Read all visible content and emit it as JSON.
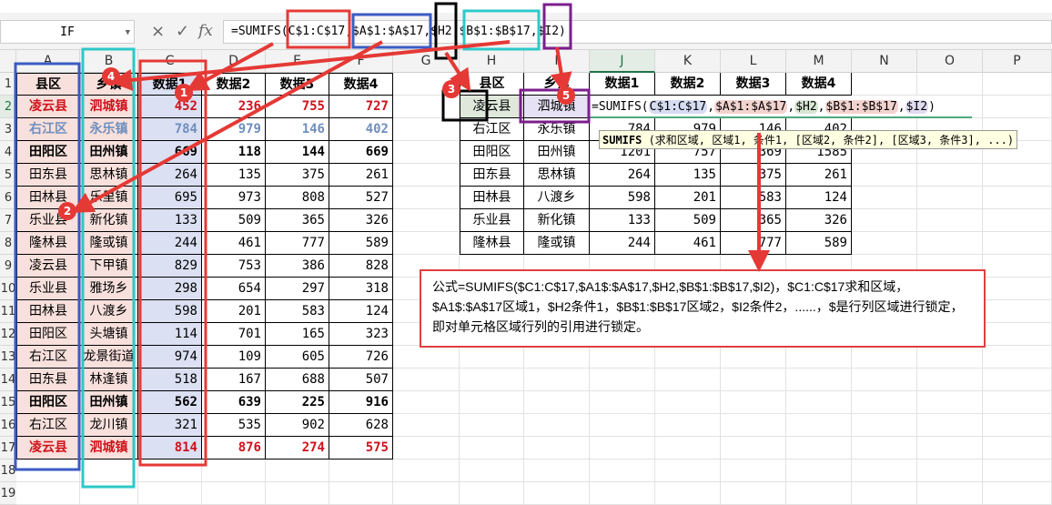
{
  "name_box": "IF",
  "formula_bar": {
    "cancel_icon": "×",
    "confirm_icon": "✓",
    "fx_label": "fx",
    "formula": "=SUMIFS(C$1:C$17,$A$1:$A$17,$H2,$B$1:$B$17,$I2)"
  },
  "columns": [
    "A",
    "B",
    "C",
    "D",
    "E",
    "F",
    "G",
    "H",
    "I",
    "J",
    "K",
    "L",
    "M",
    "N",
    "O",
    "P"
  ],
  "rows": [
    "1",
    "2",
    "3",
    "4",
    "5",
    "6",
    "7",
    "8",
    "9",
    "10",
    "11",
    "12",
    "13",
    "14",
    "15",
    "16",
    "17",
    "18",
    "19"
  ],
  "left_table": {
    "headers": [
      "县区",
      "乡镇",
      "数据1",
      "数据2",
      "数据3",
      "数据4"
    ],
    "rows": [
      [
        "凌云县",
        "泗城镇",
        "452",
        "236",
        "755",
        "727"
      ],
      [
        "右江区",
        "永乐镇",
        "784",
        "979",
        "146",
        "402"
      ],
      [
        "田阳区",
        "田州镇",
        "669",
        "118",
        "144",
        "669"
      ],
      [
        "田东县",
        "思林镇",
        "264",
        "135",
        "375",
        "261"
      ],
      [
        "田林县",
        "乐里镇",
        "695",
        "973",
        "808",
        "527"
      ],
      [
        "乐业县",
        "新化镇",
        "133",
        "509",
        "365",
        "326"
      ],
      [
        "隆林县",
        "隆或镇",
        "244",
        "461",
        "777",
        "589"
      ],
      [
        "凌云县",
        "下甲镇",
        "829",
        "753",
        "386",
        "828"
      ],
      [
        "乐业县",
        "雅场乡",
        "298",
        "654",
        "297",
        "318"
      ],
      [
        "田林县",
        "八渡乡",
        "598",
        "201",
        "583",
        "124"
      ],
      [
        "田阳区",
        "头塘镇",
        "114",
        "701",
        "165",
        "323"
      ],
      [
        "右江区",
        "龙景街道",
        "974",
        "109",
        "605",
        "726"
      ],
      [
        "田东县",
        "林逢镇",
        "518",
        "167",
        "688",
        "507"
      ],
      [
        "田阳区",
        "田州镇",
        "562",
        "639",
        "225",
        "916"
      ],
      [
        "右江区",
        "龙川镇",
        "321",
        "535",
        "902",
        "628"
      ],
      [
        "凌云县",
        "泗城镇",
        "814",
        "876",
        "274",
        "575"
      ]
    ],
    "row_styles": [
      "red",
      "blue",
      "bold",
      "",
      "",
      "",
      "",
      "",
      "",
      "",
      "",
      "",
      "",
      "bold",
      "",
      "red"
    ]
  },
  "right_table": {
    "headers": [
      "县区",
      "乡镇",
      "数据1",
      "数据2",
      "数据3",
      "数据4"
    ],
    "rows": [
      [
        "凌云县",
        "泗城镇",
        "",
        "",
        "",
        ""
      ],
      [
        "右江区",
        "永乐镇",
        "784",
        "979",
        "146",
        "402"
      ],
      [
        "田阳区",
        "田州镇",
        "1201",
        "757",
        "369",
        "1585"
      ],
      [
        "田东县",
        "思林镇",
        "264",
        "135",
        "375",
        "261"
      ],
      [
        "田林县",
        "八渡乡",
        "598",
        "201",
        "583",
        "124"
      ],
      [
        "乐业县",
        "新化镇",
        "133",
        "509",
        "365",
        "326"
      ],
      [
        "隆林县",
        "隆或镇",
        "244",
        "461",
        "777",
        "589"
      ]
    ]
  },
  "edit_cell": {
    "prefix": "=SUMIFS(",
    "arg1": "C$1:C$17",
    "arg2": "$A$1:$A$17",
    "arg3": "$H2",
    "arg4": "$B$1:$B$17",
    "arg5": "$I2",
    "sep": ",",
    "suffix": ")"
  },
  "tooltip": {
    "fn": "SUMIFS",
    "args": " (求和区域, 区域1, 条件1, [区域2, 条件2], [区域3, 条件3], ...)"
  },
  "note": "公式=SUMIFS($C1:C$17,$A1$:$A$17,$H2,$B$1:$B$17,$I2)，$C1:C$17求和区域，$A1$:$A$17区域1，$H2条件1，$B$1:$B$17区域2，$I2条件2，......，$是行列区域进行锁定，即对单元格区域行列的引用进行锁定。",
  "badges": [
    "1",
    "2",
    "3",
    "4",
    "5"
  ],
  "colors": {
    "red": "#e53935",
    "blue": "#3b5bc4",
    "cyan": "#2cc9c9",
    "black": "#000000",
    "purple": "#7b1e8c"
  }
}
